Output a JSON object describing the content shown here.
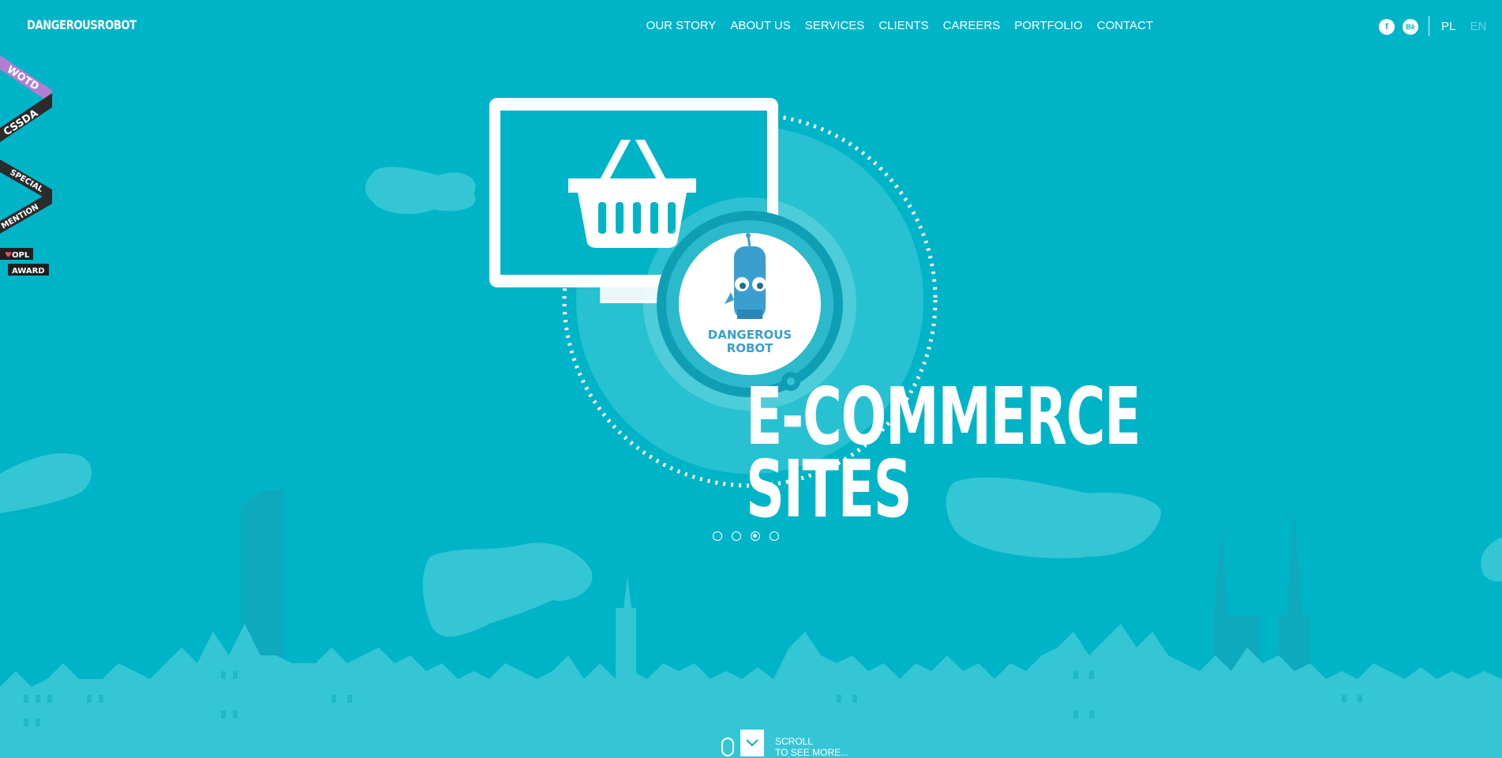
{
  "brand": {
    "logo_text": "DANGEROUSROBOT"
  },
  "nav": {
    "items": [
      "OUR STORY",
      "ABOUT US",
      "SERVICES",
      "CLIENTS",
      "CAREERS",
      "PORTFOLIO",
      "CONTACT"
    ]
  },
  "social": {
    "facebook": "f",
    "behance": "Bē"
  },
  "language": {
    "pl": "PL",
    "en": "EN",
    "active": "EN"
  },
  "awards": {
    "wotd": "WOTD",
    "cssda": "CSSDA",
    "special": "SPECIAL",
    "mention": "MENTION",
    "opl": "OPL",
    "award": "AWARD"
  },
  "hero": {
    "headline_line1": "E-COMMERCE",
    "headline_line2": "SITES",
    "badge_text_line1": "DANGEROUS",
    "badge_text_line2": "ROBOT"
  },
  "slider": {
    "count": 4,
    "active_index": 2
  },
  "scroll": {
    "line1": "SCROLL",
    "line2": "TO SEE MORE..."
  },
  "colors": {
    "background": "#00b4c8",
    "light_shape": "#34c6d5",
    "dark_shape": "#0a9db2",
    "white": "#ffffff"
  }
}
